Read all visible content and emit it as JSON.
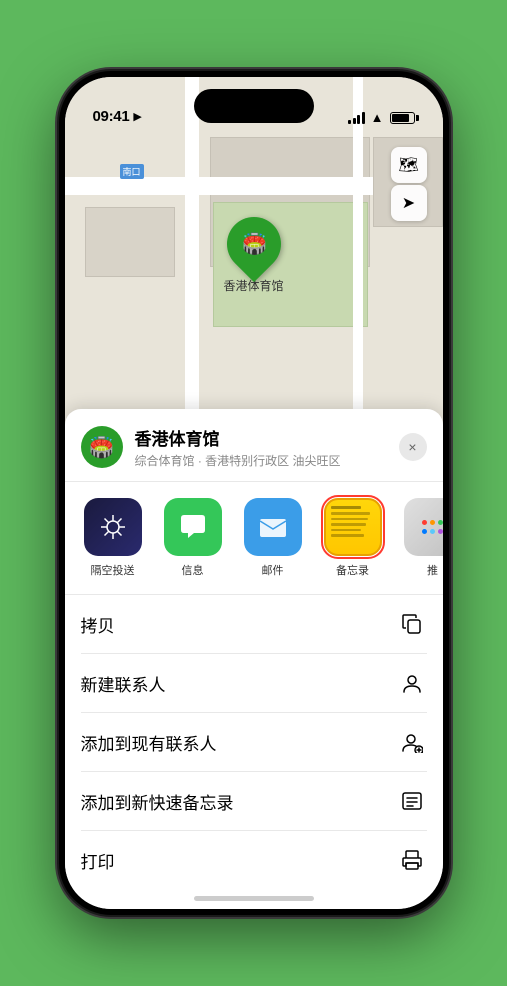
{
  "status_bar": {
    "time": "09:41",
    "location_arrow": "▶"
  },
  "map": {
    "road_sign": "南口",
    "pin_label": "香港体育馆"
  },
  "location_header": {
    "name": "香港体育馆",
    "subtitle": "综合体育馆 · 香港特别行政区 油尖旺区"
  },
  "share_items": [
    {
      "id": "airdrop",
      "label": "隔空投送",
      "icon_type": "airdrop"
    },
    {
      "id": "messages",
      "label": "信息",
      "icon_type": "messages"
    },
    {
      "id": "mail",
      "label": "邮件",
      "icon_type": "mail"
    },
    {
      "id": "notes",
      "label": "备忘录",
      "icon_type": "notes"
    },
    {
      "id": "more",
      "label": "推",
      "icon_type": "more"
    }
  ],
  "action_items": [
    {
      "id": "copy",
      "label": "拷贝",
      "icon": "📋"
    },
    {
      "id": "new-contact",
      "label": "新建联系人",
      "icon": "👤"
    },
    {
      "id": "add-contact",
      "label": "添加到现有联系人",
      "icon": "👤"
    },
    {
      "id": "quick-note",
      "label": "添加到新快速备忘录",
      "icon": "📝"
    },
    {
      "id": "print",
      "label": "打印",
      "icon": "🖨️"
    }
  ],
  "buttons": {
    "close": "×"
  }
}
